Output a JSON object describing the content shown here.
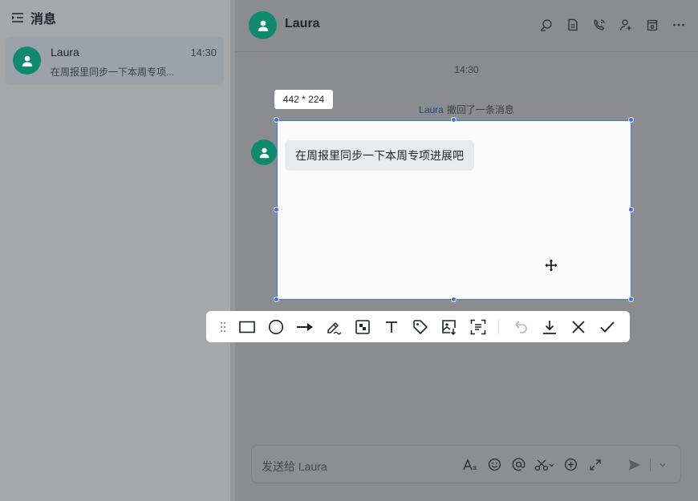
{
  "sidebar": {
    "title": "消息",
    "conversations": [
      {
        "name": "Laura",
        "time": "14:30",
        "preview": "在周报里同步一下本周专项..."
      }
    ]
  },
  "chat": {
    "title": "Laura",
    "header_icons": [
      "search-icon",
      "doc-icon",
      "phone-icon",
      "add-member-icon",
      "archive-icon",
      "more-icon"
    ],
    "time_separator": "14:30",
    "recall_notice": {
      "who": "Laura",
      "text": "撤回了一条消息"
    },
    "message": "在周报里同步一下本周专项进展吧",
    "input": {
      "placeholder": "发送给 Laura",
      "icons": [
        "font-icon",
        "emoji-icon",
        "mention-icon",
        "scissors-icon",
        "plus-icon",
        "expand-icon",
        "send-icon",
        "chevron-down-icon"
      ]
    }
  },
  "capture": {
    "size_label": "442 * 224",
    "tools": [
      "drag-handle-icon",
      "rectangle-icon",
      "circle-icon",
      "arrow-icon",
      "pen-icon",
      "mosaic-icon",
      "text-icon",
      "tag-icon",
      "image-icon",
      "ocr-icon",
      "undo-icon",
      "download-icon",
      "close-icon",
      "confirm-icon"
    ]
  },
  "colors": {
    "accent": "#3b7bea",
    "avatar": "#0f8a6e"
  }
}
